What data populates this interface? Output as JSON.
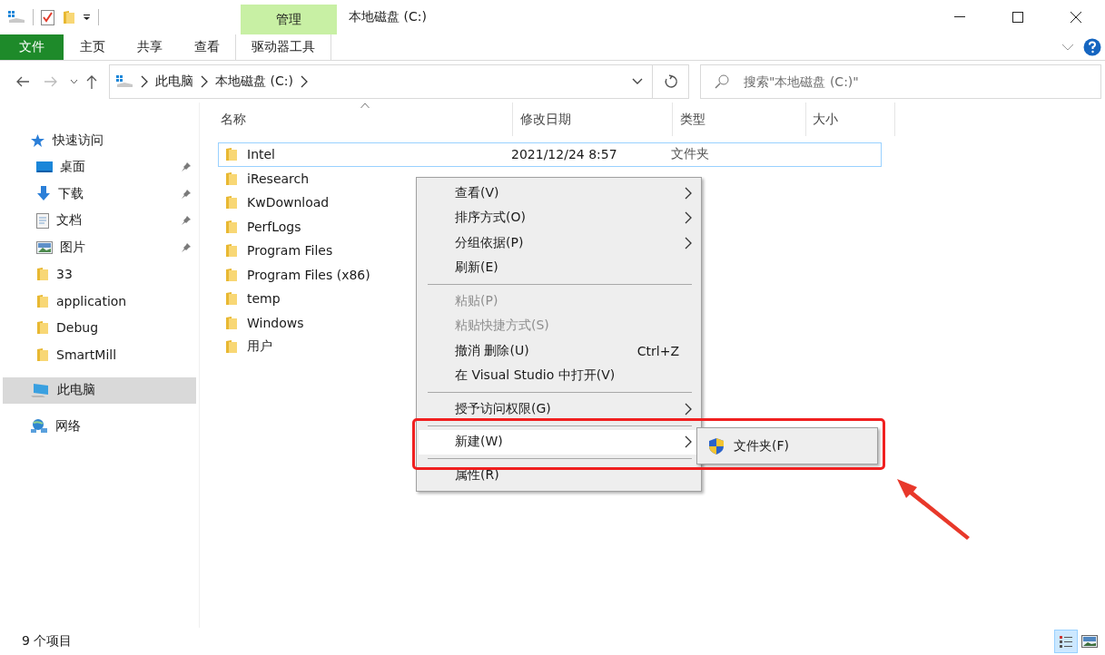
{
  "window": {
    "title": "本地磁盘 (C:)"
  },
  "ribbon": {
    "context_group": "管理",
    "tabs": [
      {
        "label": "文件",
        "kind": "file"
      },
      {
        "label": "主页",
        "kind": "normal"
      },
      {
        "label": "共享",
        "kind": "normal"
      },
      {
        "label": "查看",
        "kind": "normal"
      },
      {
        "label": "驱动器工具",
        "kind": "contextual"
      }
    ]
  },
  "address_bar": {
    "breadcrumbs": [
      "此电脑",
      "本地磁盘 (C:)"
    ]
  },
  "search": {
    "placeholder": "搜索\"本地磁盘 (C:)\""
  },
  "sidebar": {
    "items": [
      {
        "label": "快速访问",
        "kind": "star",
        "selected": false,
        "pinned": false,
        "children": [
          {
            "label": "桌面",
            "kind": "desktop",
            "selected": false,
            "pinned": true
          },
          {
            "label": "下载",
            "kind": "download",
            "selected": false,
            "pinned": true
          },
          {
            "label": "文档",
            "kind": "document",
            "selected": false,
            "pinned": true
          },
          {
            "label": "图片",
            "kind": "picture",
            "selected": false,
            "pinned": true
          },
          {
            "label": "33",
            "kind": "folder",
            "selected": false,
            "pinned": false
          },
          {
            "label": "application",
            "kind": "folder",
            "selected": false,
            "pinned": false
          },
          {
            "label": "Debug",
            "kind": "folder",
            "selected": false,
            "pinned": false
          },
          {
            "label": "SmartMill",
            "kind": "folder",
            "selected": false,
            "pinned": false
          }
        ]
      },
      {
        "label": "此电脑",
        "kind": "pc",
        "selected": true,
        "pinned": false
      },
      {
        "label": "网络",
        "kind": "network",
        "selected": false,
        "pinned": false
      }
    ]
  },
  "file_list": {
    "columns": [
      {
        "label": "名称",
        "sorted": true
      },
      {
        "label": "修改日期",
        "sorted": false
      },
      {
        "label": "类型",
        "sorted": false
      },
      {
        "label": "大小",
        "sorted": false
      }
    ],
    "rows": [
      {
        "name": "Intel",
        "modified": "2021/12/24 8:57",
        "type": "文件夹",
        "focused": true
      },
      {
        "name": "iResearch",
        "focused": false
      },
      {
        "name": "KwDownload",
        "focused": false
      },
      {
        "name": "PerfLogs",
        "focused": false
      },
      {
        "name": "Program Files",
        "focused": false
      },
      {
        "name": "Program Files (x86)",
        "focused": false
      },
      {
        "name": "temp",
        "focused": false
      },
      {
        "name": "Windows",
        "focused": false
      },
      {
        "name": "用户",
        "focused": false
      }
    ]
  },
  "context_menu": {
    "items": [
      {
        "kind": "item",
        "label": "查看(V)",
        "submenu": true,
        "disabled": false,
        "selected": false
      },
      {
        "kind": "item",
        "label": "排序方式(O)",
        "submenu": true,
        "disabled": false,
        "selected": false
      },
      {
        "kind": "item",
        "label": "分组依据(P)",
        "submenu": true,
        "disabled": false,
        "selected": false
      },
      {
        "kind": "item",
        "label": "刷新(E)",
        "submenu": false,
        "disabled": false,
        "selected": false
      },
      {
        "kind": "separator"
      },
      {
        "kind": "item",
        "label": "粘贴(P)",
        "submenu": false,
        "disabled": true,
        "selected": false
      },
      {
        "kind": "item",
        "label": "粘贴快捷方式(S)",
        "submenu": false,
        "disabled": true,
        "selected": false
      },
      {
        "kind": "item",
        "label": "撤消 删除(U)",
        "shortcut": "Ctrl+Z",
        "submenu": false,
        "disabled": false,
        "selected": false
      },
      {
        "kind": "item",
        "label": "在 Visual Studio 中打开(V)",
        "submenu": false,
        "disabled": false,
        "selected": false
      },
      {
        "kind": "separator"
      },
      {
        "kind": "item",
        "label": "授予访问权限(G)",
        "submenu": true,
        "disabled": false,
        "selected": false
      },
      {
        "kind": "separator"
      },
      {
        "kind": "item",
        "label": "新建(W)",
        "submenu": true,
        "disabled": false,
        "selected": true
      },
      {
        "kind": "separator"
      },
      {
        "kind": "item",
        "label": "属性(R)",
        "submenu": false,
        "disabled": false,
        "selected": false
      }
    ]
  },
  "submenu": {
    "items": [
      {
        "label": "文件夹(F)",
        "selected": false
      }
    ]
  },
  "status_bar": {
    "item_count": "9 个项目",
    "views": [
      {
        "kind": "details",
        "selected": true
      },
      {
        "kind": "thumbnails",
        "selected": false
      }
    ]
  }
}
